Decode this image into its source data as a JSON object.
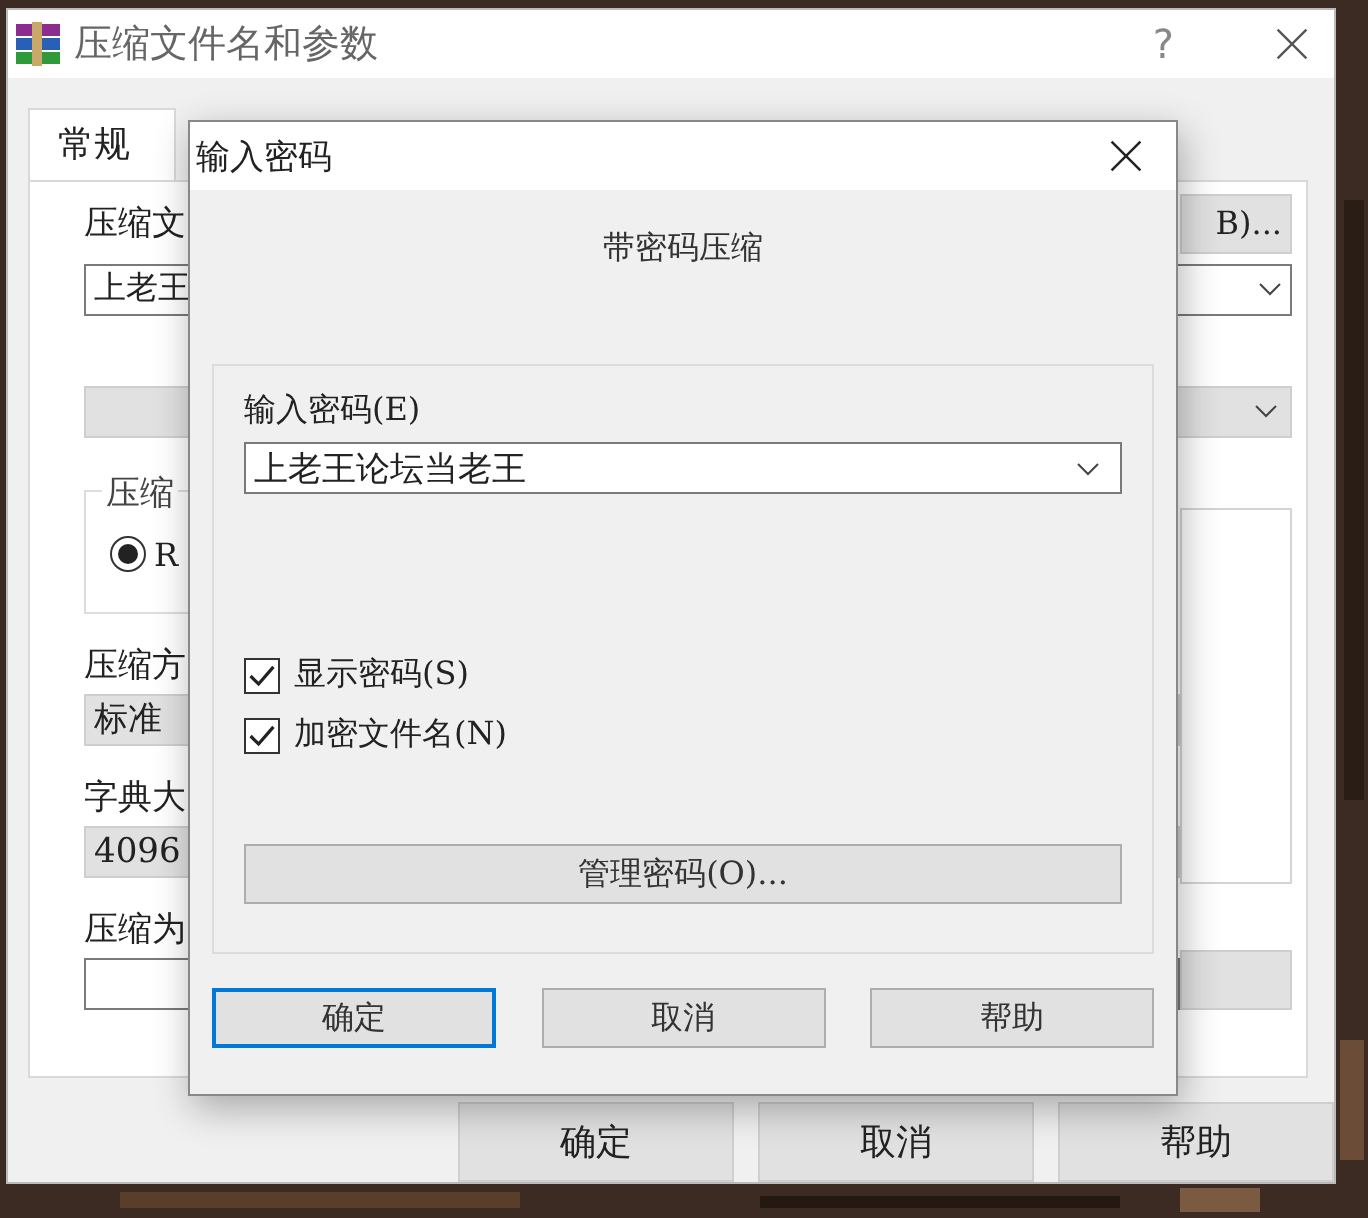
{
  "window": {
    "title": "压缩文件名和参数",
    "help_button": "?"
  },
  "tabs": [
    {
      "label": "常规",
      "selected": true
    }
  ],
  "general": {
    "archive_name_label": "压缩文",
    "browse_button": "B)...",
    "archive_name": "上老王",
    "format_group_label": "压缩",
    "format_option": {
      "label": "R",
      "selected": true
    },
    "method_label": "压缩方",
    "method_value": "标准",
    "dictionary_label": "字典大",
    "dictionary_value": "4096",
    "split_label": "压缩为"
  },
  "buttons": [
    {
      "label": "确定"
    },
    {
      "label": "取消"
    },
    {
      "label": "帮助"
    }
  ],
  "password_dialog": {
    "title": "输入密码",
    "heading": "带密码压缩",
    "password_label": "输入密码(E)",
    "password": "上老王论坛当老王",
    "options": [
      {
        "label": "显示密码(S)",
        "checked": true
      },
      {
        "label": "加密文件名(N)",
        "checked": true
      }
    ],
    "manage_button": "管理密码(O)...",
    "buttons": [
      {
        "label": "确定",
        "focused": true
      },
      {
        "label": "取消",
        "focused": false
      },
      {
        "label": "帮助",
        "focused": false
      }
    ]
  }
}
